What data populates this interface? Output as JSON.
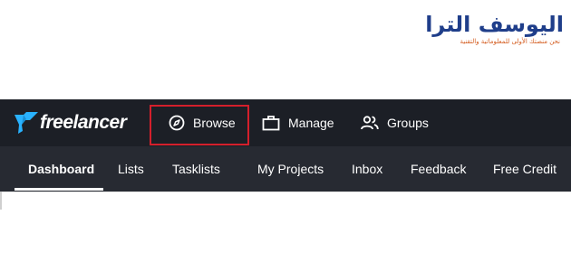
{
  "watermark": {
    "title": "اليوسف الترا",
    "subtitle": "نحن منصتك الأولى للمعلوماتية والتقنية"
  },
  "app": {
    "brand": "freelancer",
    "colors": {
      "topbar": "#1c1f26",
      "subnav": "#272a32",
      "highlight": "#d41f2b",
      "logo_bird": "#29b2fe"
    },
    "topnav": [
      {
        "label": "Browse",
        "icon": "compass-icon",
        "highlighted": true
      },
      {
        "label": "Manage",
        "icon": "briefcase-icon"
      },
      {
        "label": "Groups",
        "icon": "users-icon"
      }
    ],
    "subnav": [
      {
        "label": "Dashboard",
        "active": true
      },
      {
        "label": "Lists"
      },
      {
        "label": "Tasklists"
      },
      {
        "label": "My Projects"
      },
      {
        "label": "Inbox"
      },
      {
        "label": "Feedback"
      },
      {
        "label": "Free Credit"
      }
    ]
  }
}
